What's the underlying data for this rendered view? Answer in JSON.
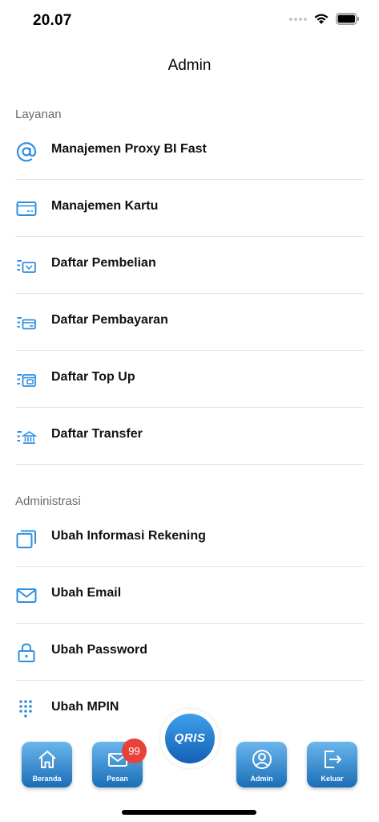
{
  "status_bar": {
    "time": "20.07"
  },
  "header": {
    "title": "Admin"
  },
  "sections": [
    {
      "title": "Layanan",
      "items": [
        {
          "label": "Manajemen Proxy BI Fast",
          "icon": "at-icon"
        },
        {
          "label": "Manajemen Kartu",
          "icon": "card-icon"
        },
        {
          "label": "Daftar Pembelian",
          "icon": "list-purchase-icon"
        },
        {
          "label": "Daftar Pembayaran",
          "icon": "list-payment-icon"
        },
        {
          "label": "Daftar Top Up",
          "icon": "list-topup-icon"
        },
        {
          "label": "Daftar Transfer",
          "icon": "list-transfer-icon"
        }
      ]
    },
    {
      "title": "Administrasi",
      "items": [
        {
          "label": "Ubah Informasi Rekening",
          "icon": "account-info-icon"
        },
        {
          "label": "Ubah Email",
          "icon": "email-icon"
        },
        {
          "label": "Ubah Password",
          "icon": "lock-icon"
        },
        {
          "label": "Ubah MPIN",
          "icon": "keypad-icon"
        }
      ]
    }
  ],
  "tabbar": {
    "tabs": [
      {
        "label": "Beranda",
        "icon": "home-icon"
      },
      {
        "label": "Pesan",
        "icon": "mail-icon",
        "badge": "99"
      },
      {
        "label": "Admin",
        "icon": "user-icon"
      },
      {
        "label": "Keluar",
        "icon": "logout-icon"
      }
    ],
    "center": {
      "label": "QRIS"
    }
  },
  "colors": {
    "accent": "#1e7fd0",
    "icon": "#2f8fe0",
    "badge": "#e8413a",
    "divider": "#e4e4e4"
  }
}
